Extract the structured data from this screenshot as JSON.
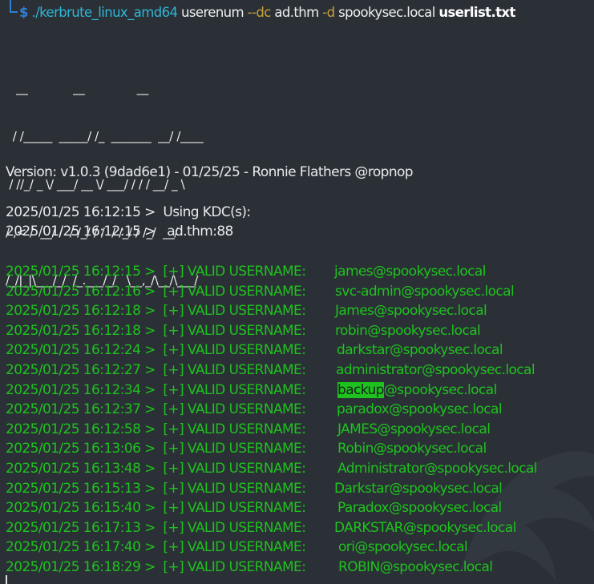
{
  "command": {
    "prompt_symbol": "$",
    "executable": "./kerbrute_linux_amd64",
    "subcommand": "userenum",
    "dc_flag": "--dc",
    "dc_value": "ad.thm",
    "domain_flag": "-d",
    "domain_value": "spookysec.local",
    "userlist": "userlist.txt"
  },
  "banner": {
    "ascii_lines": [
      "   __             __               __     ",
      "  / /_____  _____/ /_  _______  __/ /____ ",
      " / //_/ _ \\/ ___/ __ \\/ ___/ / / / __/ _ \\",
      "/ ,< /  __/ /  / /_/ / /  / /_/ / /_/  __/",
      "/_/|_|\\___/_/  /_.___/_/   \\__,_/\\__/\\___/ "
    ],
    "version_line": "Version: v1.0.3 (9dad6e1) - 01/25/25 - Ronnie Flathers @ropnop"
  },
  "kdc_lines": [
    "2025/01/25 16:12:15 >  Using KDC(s):",
    "2025/01/25 16:12:15 >   ad.thm:88"
  ],
  "results": [
    {
      "prefix": "2025/01/25 16:12:15 >  [+] VALID USERNAME:",
      "user": "james@spookysec.local"
    },
    {
      "prefix": "2025/01/25 16:12:16 >  [+] VALID USERNAME:",
      "user": "svc-admin@spookysec.local"
    },
    {
      "prefix": "2025/01/25 16:12:18 >  [+] VALID USERNAME:",
      "user": "James@spookysec.local"
    },
    {
      "prefix": "2025/01/25 16:12:18 >  [+] VALID USERNAME:",
      "user": "robin@spookysec.local"
    },
    {
      "prefix": "2025/01/25 16:12:24 >  [+] VALID USERNAME:",
      "user": "darkstar@spookysec.local"
    },
    {
      "prefix": "2025/01/25 16:12:27 >  [+] VALID USERNAME:",
      "user": "administrator@spookysec.local"
    },
    {
      "prefix": "2025/01/25 16:12:34 >  [+] VALID USERNAME:",
      "user_highlight": "backup",
      "user_rest": "@spookysec.local"
    },
    {
      "prefix": "2025/01/25 16:12:37 >  [+] VALID USERNAME:",
      "user": "paradox@spookysec.local"
    },
    {
      "prefix": "2025/01/25 16:12:58 >  [+] VALID USERNAME:",
      "user": "JAMES@spookysec.local"
    },
    {
      "prefix": "2025/01/25 16:13:06 >  [+] VALID USERNAME:",
      "user": "Robin@spookysec.local"
    },
    {
      "prefix": "2025/01/25 16:13:48 >  [+] VALID USERNAME:",
      "user": "Administrator@spookysec.local"
    },
    {
      "prefix": "2025/01/25 16:15:13 >  [+] VALID USERNAME:",
      "user": "Darkstar@spookysec.local"
    },
    {
      "prefix": "2025/01/25 16:15:40 >  [+] VALID USERNAME:",
      "user": "Paradox@spookysec.local"
    },
    {
      "prefix": "2025/01/25 16:17:13 >  [+] VALID USERNAME:",
      "user": "DARKSTAR@spookysec.local"
    },
    {
      "prefix": "2025/01/25 16:17:40 >  [+] VALID USERNAME:",
      "user": "ori@spookysec.local"
    },
    {
      "prefix": "2025/01/25 16:18:29 >  [+] VALID USERNAME:",
      "user": "ROBIN@spookysec.local"
    }
  ],
  "colors": {
    "background": "#2b3036",
    "success_green": "#1ec21e",
    "prompt_blue": "#2f7fd1",
    "exe_cyan": "#2fb6d6",
    "flag_gold": "#c7a23a"
  },
  "icons": {
    "watermark": "kali-dragon-icon"
  }
}
